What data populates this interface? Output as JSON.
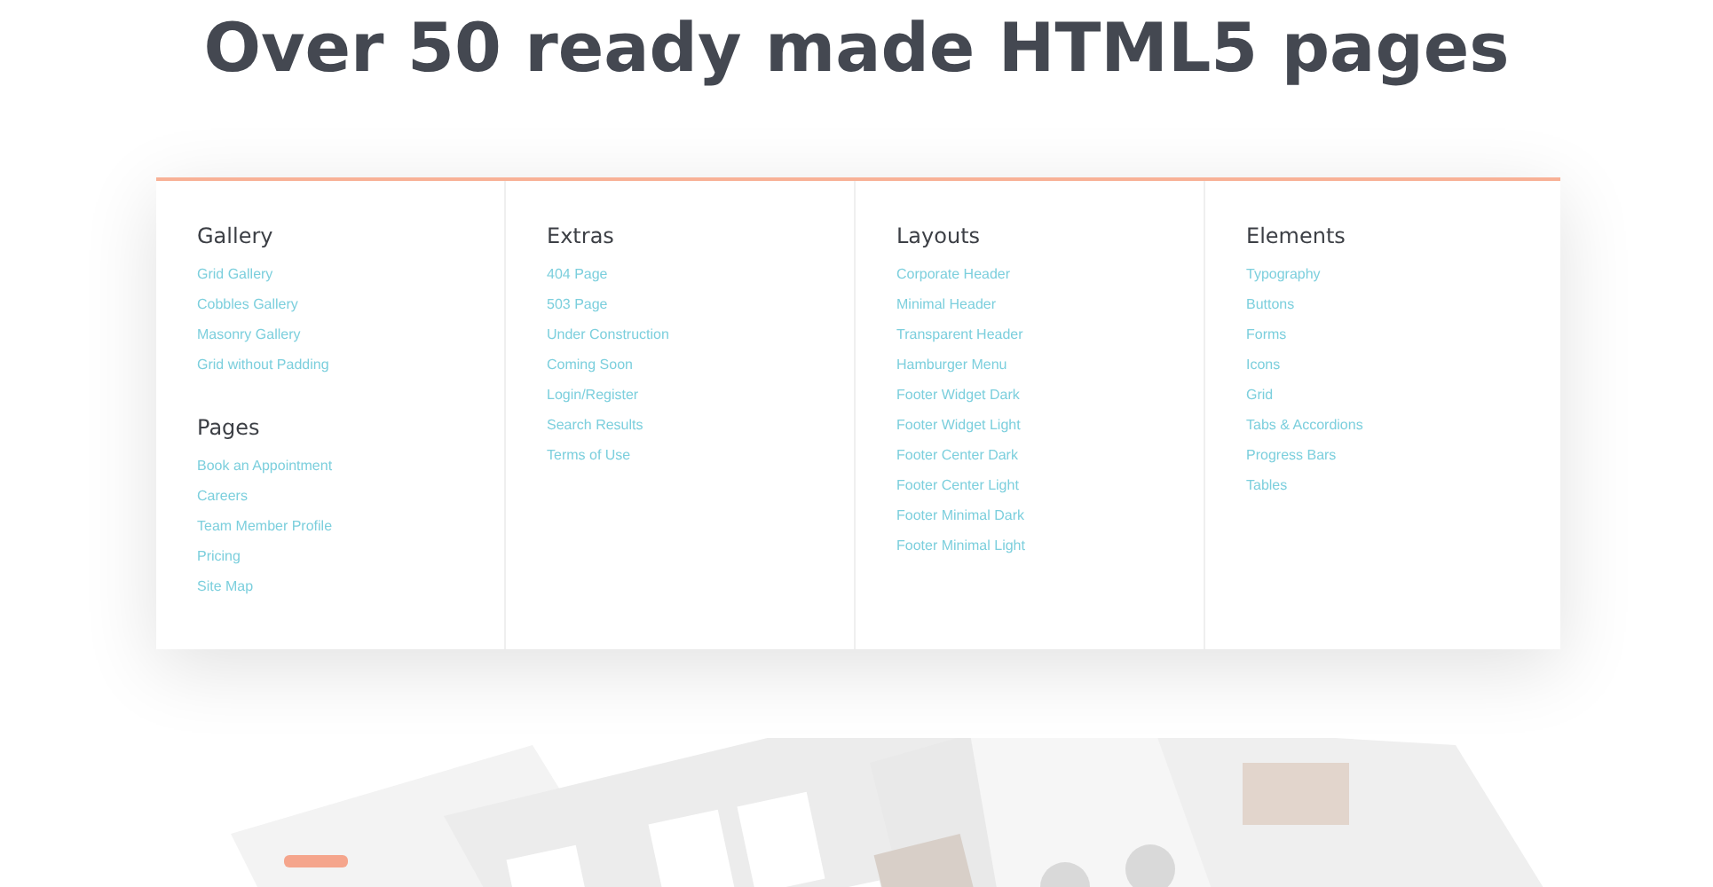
{
  "heading": "Over 50 ready made HTML5 pages",
  "menu": {
    "columns": [
      {
        "groups": [
          {
            "title": "Gallery",
            "links": [
              "Grid Gallery",
              "Cobbles Gallery",
              "Masonry Gallery",
              "Grid without Padding"
            ]
          },
          {
            "title": "Pages",
            "links": [
              "Book an Appointment",
              "Careers",
              "Team Member Profile",
              "Pricing",
              "Site Map"
            ]
          }
        ]
      },
      {
        "groups": [
          {
            "title": "Extras",
            "links": [
              "404 Page",
              "503 Page",
              "Under Construction",
              "Coming Soon",
              "Login/Register",
              "Search Results",
              "Terms of Use"
            ]
          }
        ]
      },
      {
        "groups": [
          {
            "title": "Layouts",
            "links": [
              "Corporate Header",
              "Minimal Header",
              "Transparent Header",
              "Hamburger Menu",
              "Footer Widget Dark",
              "Footer Widget Light",
              "Footer Center Dark",
              "Footer Center Light",
              "Footer Minimal Dark",
              "Footer Minimal Light"
            ]
          }
        ]
      },
      {
        "groups": [
          {
            "title": "Elements",
            "links": [
              "Typography",
              "Buttons",
              "Forms",
              "Icons",
              "Grid",
              "Tabs & Accordions",
              "Progress Bars",
              "Tables"
            ]
          }
        ]
      }
    ]
  }
}
